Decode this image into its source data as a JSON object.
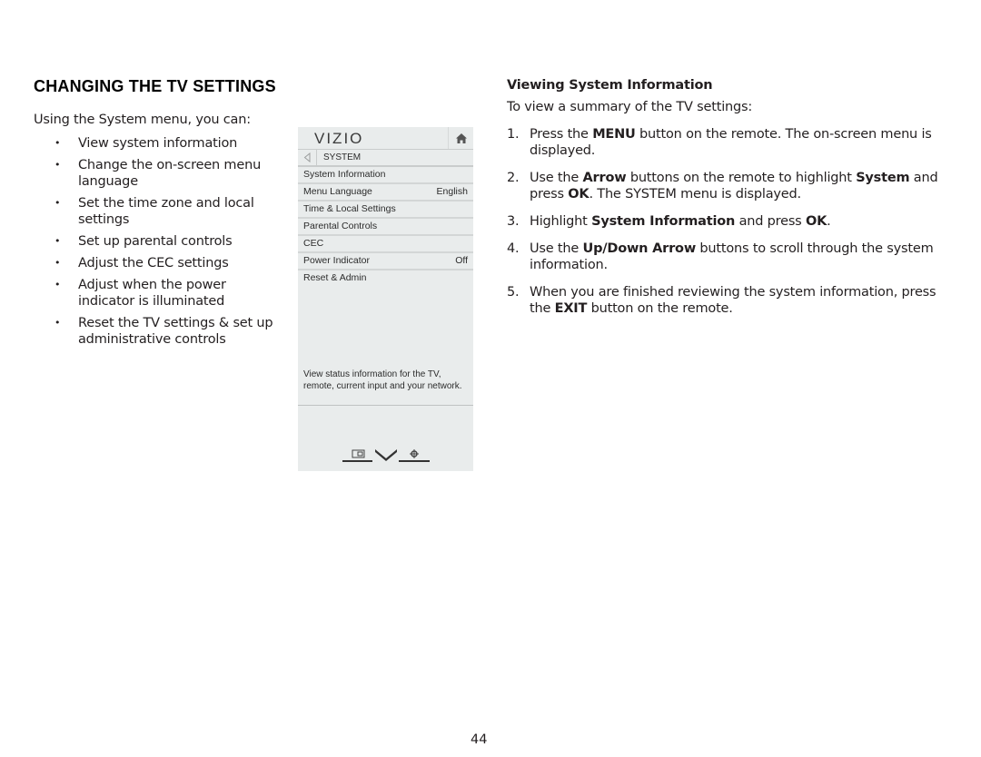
{
  "left": {
    "title": "CHANGING THE TV SETTINGS",
    "intro": "Using the System menu, you can:",
    "bullet_glyph": "•",
    "bullets": [
      "View system information",
      "Change the on-screen menu language",
      "Set the time zone and local settings",
      "Set up parental controls",
      "Adjust the CEC settings",
      "Adjust when the power indicator is illuminated",
      "Reset the TV settings & set up administrative controls"
    ]
  },
  "tv_menu": {
    "brand": "VIZIO",
    "header_icons": [
      "home-icon"
    ],
    "submenu_title": "SYSTEM",
    "back_icon": "back-arrow-icon",
    "items": [
      {
        "label": "System Information",
        "value": ""
      },
      {
        "label": "Menu Language",
        "value": "English"
      },
      {
        "label": "Time & Local Settings",
        "value": ""
      },
      {
        "label": "Parental Controls",
        "value": ""
      },
      {
        "label": "CEC",
        "value": ""
      },
      {
        "label": "Power Indicator",
        "value": "Off"
      },
      {
        "label": "Reset & Admin",
        "value": ""
      }
    ],
    "description": "View status information for the TV, remote, current input and your network.",
    "footer_icons": [
      "input-icon",
      "vizio-v-icon",
      "gear-icon"
    ],
    "colors": {
      "background": "#e9ecec",
      "divider": "#d3d6d6"
    }
  },
  "right": {
    "title": "Viewing System Information",
    "intro": "To view a summary of the TV settings:",
    "steps": [
      {
        "num": "1.",
        "parts": [
          {
            "t": "Press the "
          },
          {
            "t": "MENU",
            "b": true
          },
          {
            "t": " button on the remote. The on-screen menu is displayed."
          }
        ]
      },
      {
        "num": "2.",
        "parts": [
          {
            "t": "Use the "
          },
          {
            "t": "Arrow",
            "b": true
          },
          {
            "t": " buttons on the remote to highlight "
          },
          {
            "t": "System",
            "b": true
          },
          {
            "t": " and press "
          },
          {
            "t": "OK",
            "b": true
          },
          {
            "t": ". The SYSTEM menu is displayed."
          }
        ]
      },
      {
        "num": "3.",
        "parts": [
          {
            "t": "Highlight "
          },
          {
            "t": "System Information",
            "b": true
          },
          {
            "t": " and press "
          },
          {
            "t": "OK",
            "b": true
          },
          {
            "t": "."
          }
        ]
      },
      {
        "num": "4.",
        "parts": [
          {
            "t": "Use the "
          },
          {
            "t": "Up/Down Arrow",
            "b": true
          },
          {
            "t": " buttons to scroll through the system information."
          }
        ]
      },
      {
        "num": "5.",
        "parts": [
          {
            "t": "When you are finished reviewing the system information, press the "
          },
          {
            "t": "EXIT",
            "b": true
          },
          {
            "t": " button on the remote."
          }
        ]
      }
    ]
  },
  "page_number": "44"
}
